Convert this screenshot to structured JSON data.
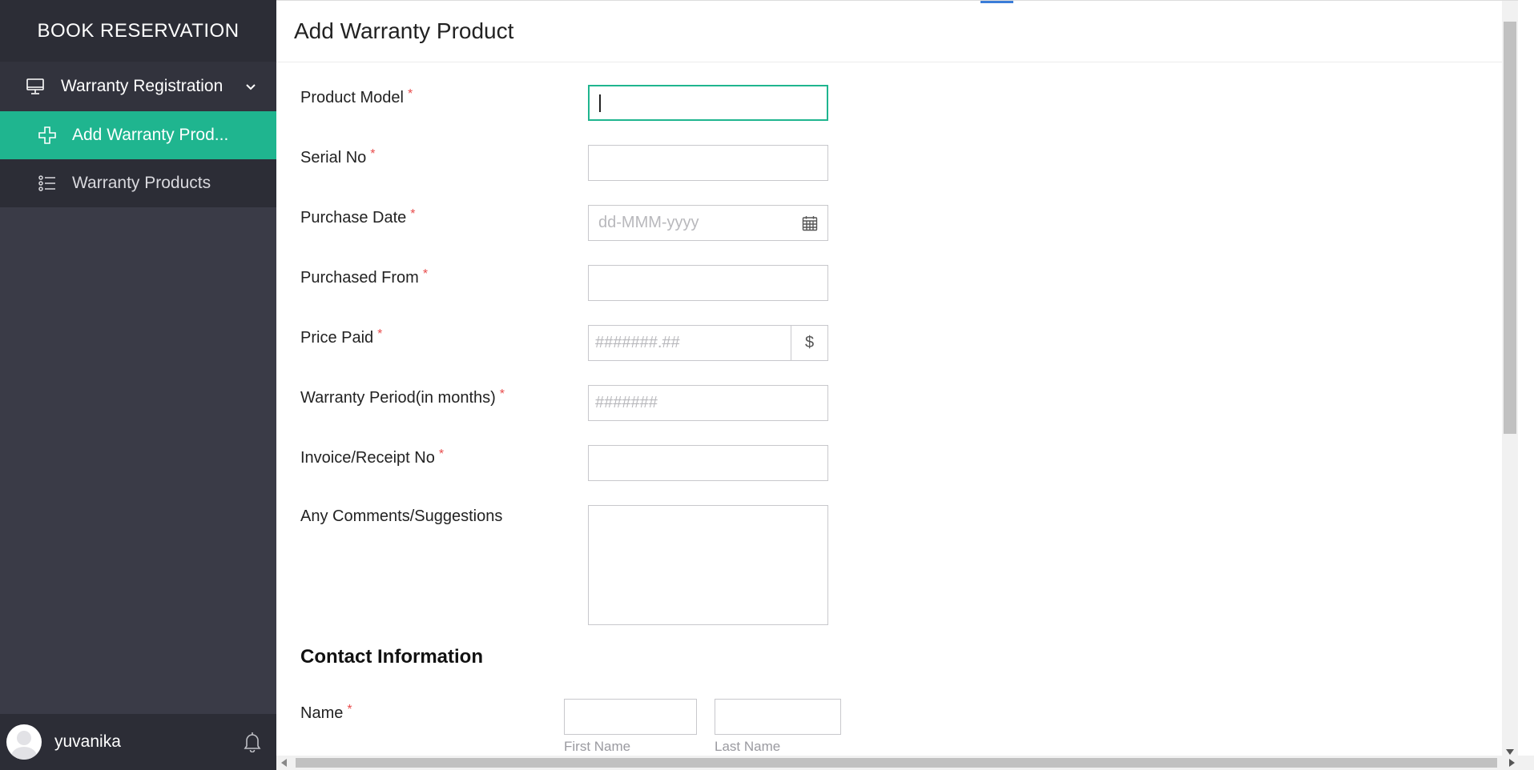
{
  "sidebar": {
    "brand": "BOOK RESERVATION",
    "group": {
      "label": "Warranty Registration",
      "icon": "monitor-icon"
    },
    "items": [
      {
        "label": "Add Warranty Prod...",
        "icon": "plus-icon",
        "active": true
      },
      {
        "label": "Warranty Products",
        "icon": "list-icon",
        "active": false
      }
    ],
    "user": {
      "name": "yuvanika"
    }
  },
  "page": {
    "title": "Add Warranty Product"
  },
  "form": {
    "product_model": {
      "label": "Product Model",
      "value": ""
    },
    "serial_no": {
      "label": "Serial No",
      "value": ""
    },
    "purchase_date": {
      "label": "Purchase Date",
      "placeholder": "dd-MMM-yyyy"
    },
    "purchased_from": {
      "label": "Purchased From",
      "value": ""
    },
    "price_paid": {
      "label": "Price Paid",
      "placeholder": "#######.##",
      "currency": "$"
    },
    "warranty_period": {
      "label": "Warranty Period(in months)",
      "placeholder": "#######"
    },
    "invoice_no": {
      "label": "Invoice/Receipt No",
      "value": ""
    },
    "comments": {
      "label": "Any Comments/Suggestions",
      "value": ""
    },
    "required_mark": "*"
  },
  "contact": {
    "section_title": "Contact Information",
    "name_label": "Name",
    "first_name": "First Name",
    "last_name": "Last Name"
  },
  "colors": {
    "accent": "#1fb58f",
    "sidebar": "#3a3b47",
    "required": "#e84c4c"
  }
}
